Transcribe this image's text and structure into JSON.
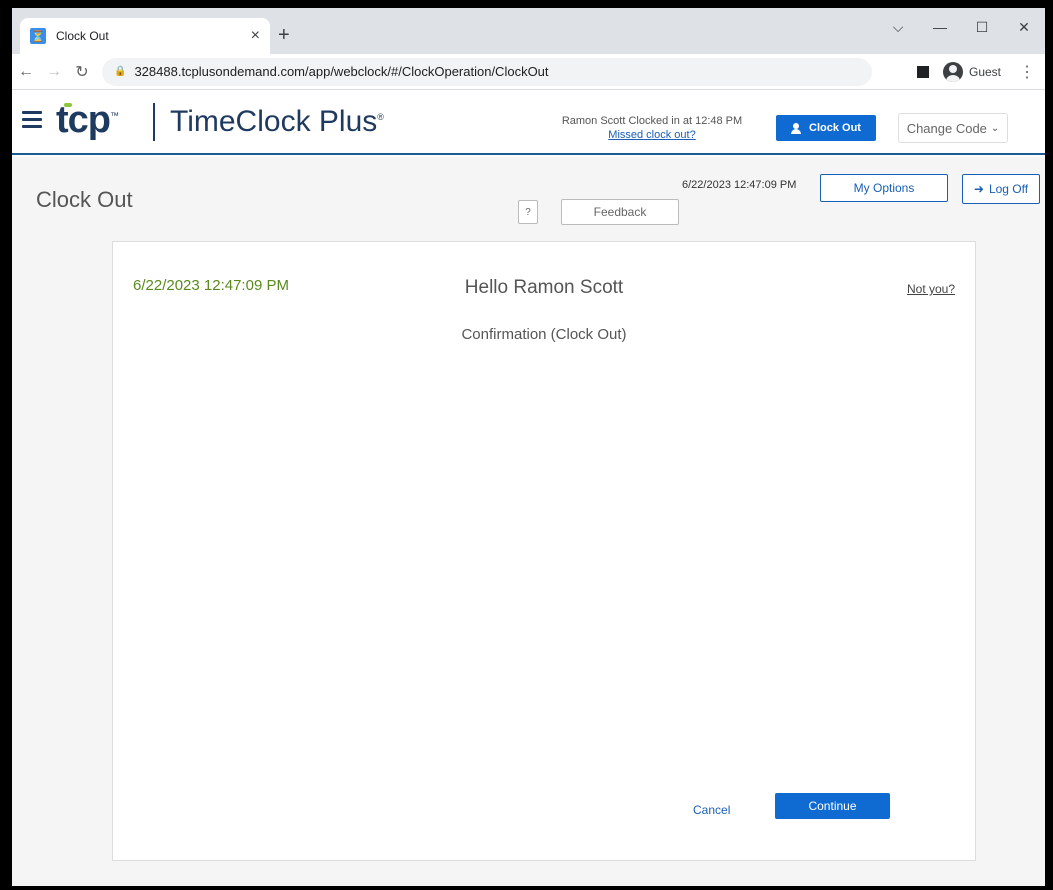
{
  "browser": {
    "tab_title": "Clock Out",
    "tab_close": "×",
    "new_tab": "+",
    "url": "328488.tcplusondemand.com/app/webclock/#/ClockOperation/ClockOut",
    "profile": "Guest"
  },
  "header": {
    "logo_text": "tcp",
    "product_name": "TimeClock Plus",
    "clocked_status": "Ramon Scott Clocked in at 12:48 PM",
    "missed_clock_out": "Missed clock out?",
    "clock_out_label": "Clock Out",
    "change_code_label": "Change Code"
  },
  "page": {
    "title": "Clock Out",
    "help_label": "?",
    "feedback_label": "Feedback",
    "server_time": "6/22/2023  12:47:09 PM",
    "my_options_label": "My Options",
    "log_off_label": "Log Off"
  },
  "card": {
    "datetime": "6/22/2023 12:47:09 PM",
    "greeting": "Hello Ramon Scott",
    "not_you": "Not you?",
    "subtitle": "Confirmation (Clock Out)",
    "cancel_label": "Cancel",
    "continue_label": "Continue"
  },
  "colors": {
    "brand_navy": "#1e3a5f",
    "primary_blue": "#0f6bd1",
    "date_green": "#5a8a1e"
  }
}
